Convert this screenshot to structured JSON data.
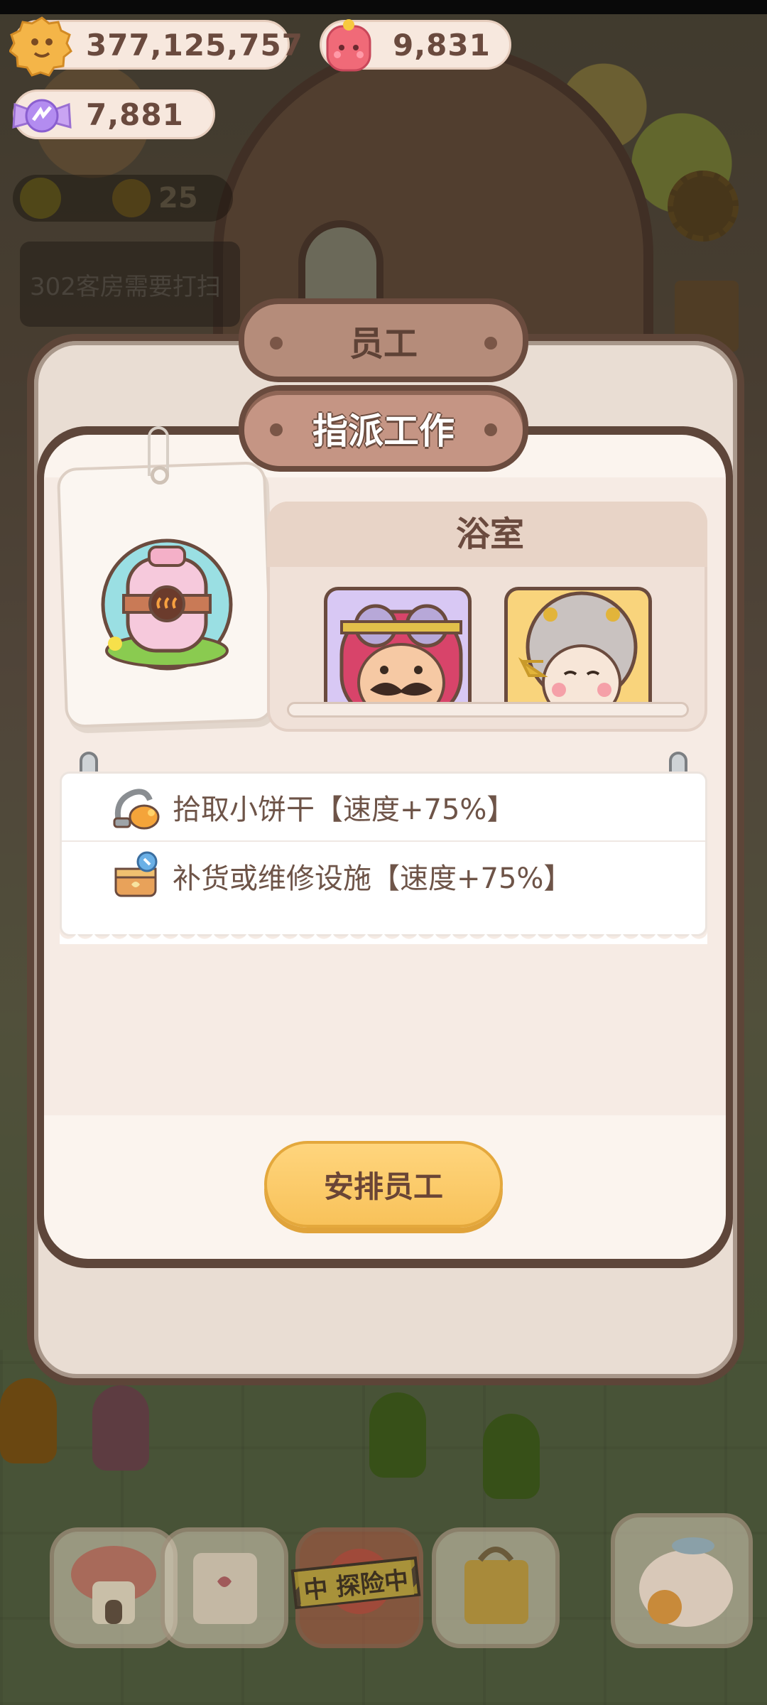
{
  "currency": {
    "cookies": "377,125,757",
    "gems": "9,831",
    "candy": "7,881"
  },
  "hud": {
    "level": "25",
    "task_notice": "302客房需要打扫"
  },
  "dialog": {
    "tab_staff": "员工",
    "tab_assign": "指派工作",
    "room_name": "浴室",
    "tasks": [
      {
        "icon": "vacuum-icon",
        "text": "拾取小饼干【速度+75%】"
      },
      {
        "icon": "toolbox-icon",
        "text": "补货或维修设施【速度+75%】"
      }
    ],
    "arrange_button": "安排员工"
  },
  "bottom_nav": {
    "explore_label": "中 探险中"
  },
  "colors": {
    "dialog_border": "#5e463a",
    "button_yellow": "#f8c25a",
    "text_brown": "#6e5448"
  }
}
